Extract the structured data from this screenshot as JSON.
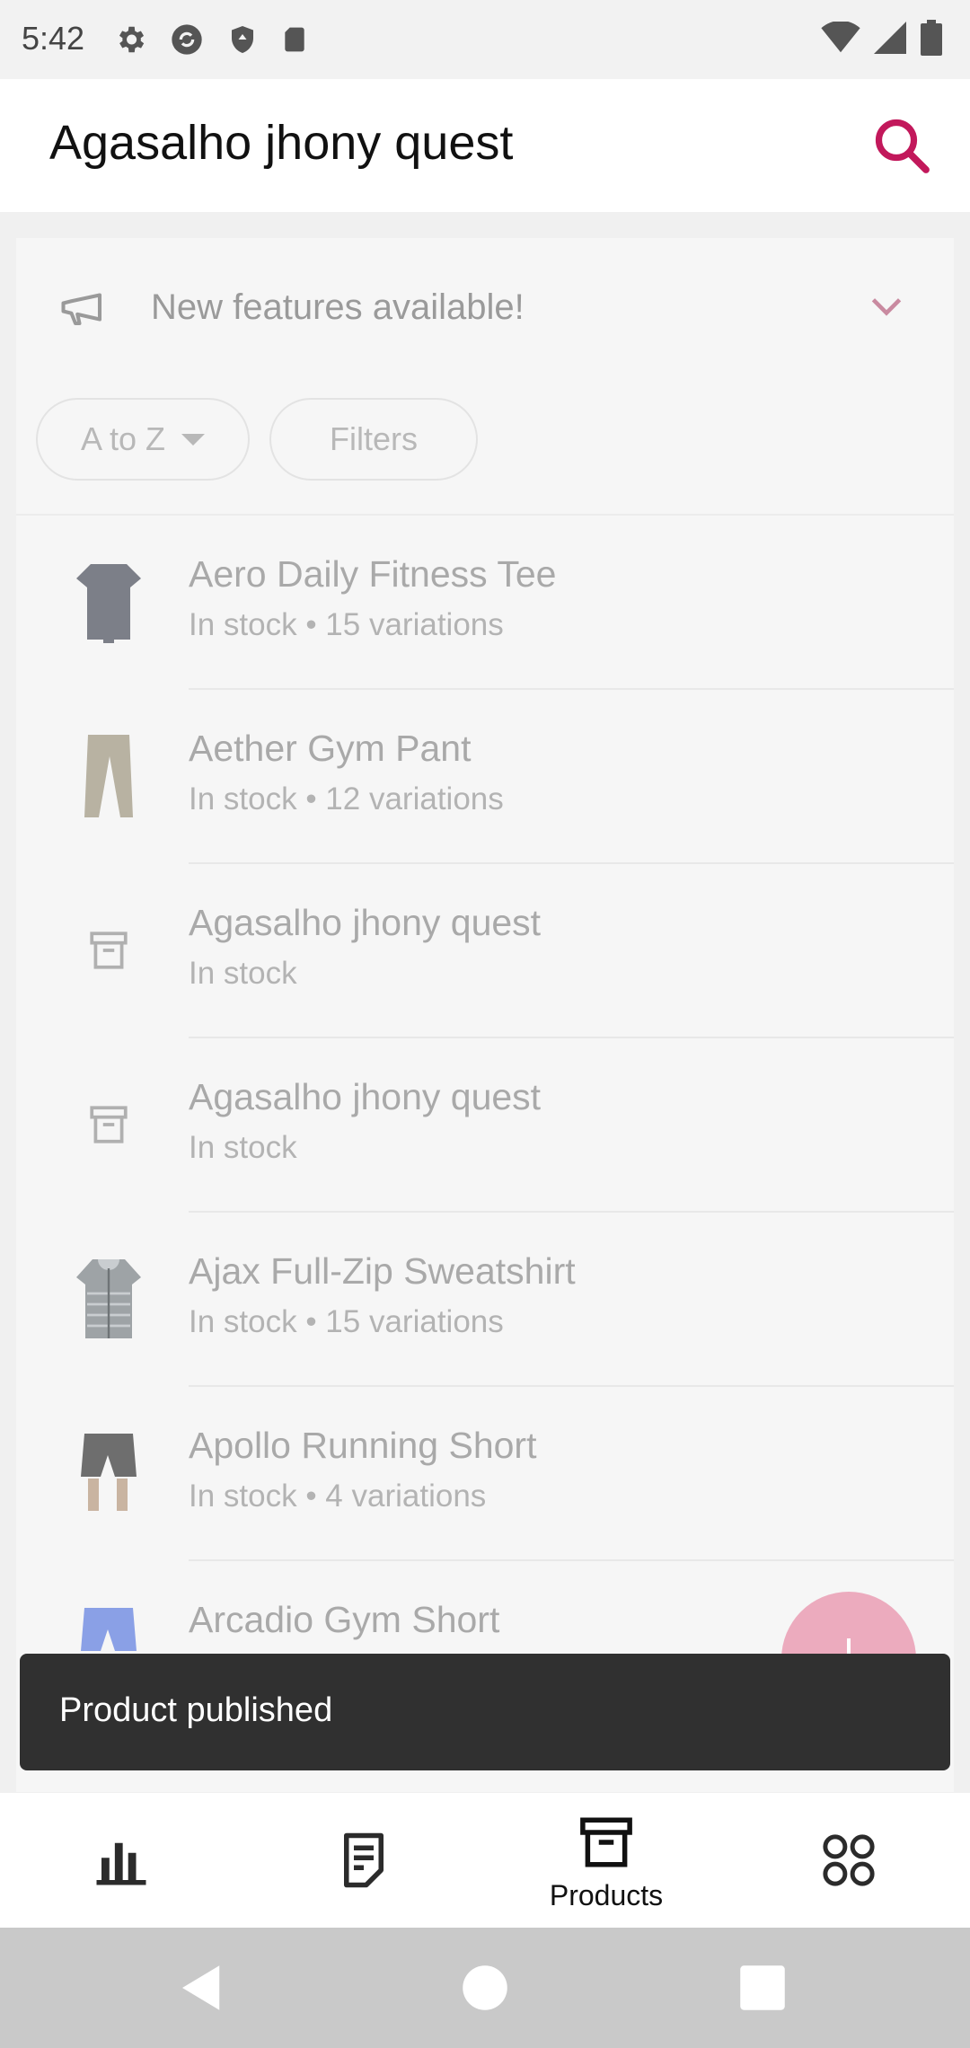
{
  "status_bar": {
    "time": "5:42",
    "icons_left": [
      "settings-icon",
      "sync-icon",
      "shield-icon",
      "sd-card-icon"
    ],
    "icons_right": [
      "wifi-icon",
      "signal-icon",
      "battery-icon"
    ]
  },
  "app_bar": {
    "title": "Agasalho jhony quest",
    "search_icon": "search-icon",
    "accent_color": "#c2185b"
  },
  "banner": {
    "icon": "megaphone-icon",
    "text": "New features available!",
    "chevron_icon": "chevron-down-icon"
  },
  "chips": {
    "sort_label": "A to Z",
    "filter_label": "Filters"
  },
  "products": [
    {
      "name": "Aero Daily Fitness Tee",
      "status": "In stock • 15 variations",
      "thumb": "tshirt-image"
    },
    {
      "name": "Aether Gym Pant",
      "status": "In stock • 12 variations",
      "thumb": "pants-image"
    },
    {
      "name": "Agasalho jhony quest",
      "status": "In stock",
      "thumb": "archive-box-icon"
    },
    {
      "name": "Agasalho jhony quest",
      "status": "In stock",
      "thumb": "archive-box-icon"
    },
    {
      "name": "Ajax Full-Zip Sweatshirt",
      "status": "In stock • 15 variations",
      "thumb": "sweatshirt-image"
    },
    {
      "name": "Apollo Running Short",
      "status": "In stock • 4 variations",
      "thumb": "shorts-image"
    },
    {
      "name": "Arcadio Gym Short",
      "status": "",
      "thumb": "blue-shorts-image"
    }
  ],
  "fab": {
    "icon": "plus-icon",
    "color": "#ecabbe"
  },
  "snackbar": {
    "text": "Product published"
  },
  "bottom_nav": {
    "items": [
      {
        "icon": "bar-chart-icon",
        "label": ""
      },
      {
        "icon": "orders-icon",
        "label": ""
      },
      {
        "icon": "archive-box-icon",
        "label": "Products"
      },
      {
        "icon": "grid-circles-icon",
        "label": ""
      }
    ]
  },
  "system_nav": {
    "icons": [
      "back-icon",
      "home-icon",
      "recents-icon"
    ]
  }
}
